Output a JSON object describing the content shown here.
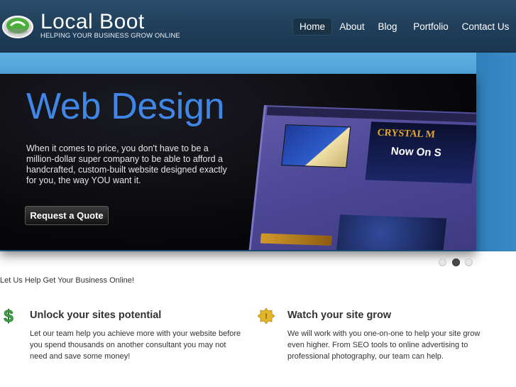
{
  "header": {
    "logo_title": "Local Boot",
    "logo_tagline": "HELPING YOUR BUSINESS GROW ONLINE",
    "nav": [
      {
        "label": "Home",
        "active": true
      },
      {
        "label": "About",
        "active": false
      },
      {
        "label": "Blog",
        "active": false
      },
      {
        "label": "Portfolio",
        "active": false
      },
      {
        "label": "Contact Us",
        "active": false
      }
    ]
  },
  "slider": {
    "title": "Web Design",
    "text": "When it comes to price, you don't have to be a million-dollar super company to be able to afford a handcrafted, custom-built website designed exactly for you, the way YOU want it.",
    "button_label": "Request a Quote",
    "dots": [
      {
        "active": false
      },
      {
        "active": true
      },
      {
        "active": false
      }
    ]
  },
  "content": {
    "tagline": "Let Us Help Get Your Business Online!",
    "features": [
      {
        "icon": "dollar-icon",
        "title": "Unlock your sites potential",
        "text": "Let our team help you achieve more with your website before you spend thousands on another consultant you may not need and save some money!"
      },
      {
        "icon": "badge-icon",
        "title": "Watch your site grow",
        "text": "We will work with you one-on-one to help your site grow even higher. From SEO tools to online advertising to professional photography, our team can help."
      }
    ]
  },
  "colors": {
    "accent_blue": "#3f86e6",
    "header_bg": "#21405c",
    "band_blue": "#4aa0d6",
    "dollar_green": "#3fa847",
    "badge_gold": "#e2b52a"
  }
}
